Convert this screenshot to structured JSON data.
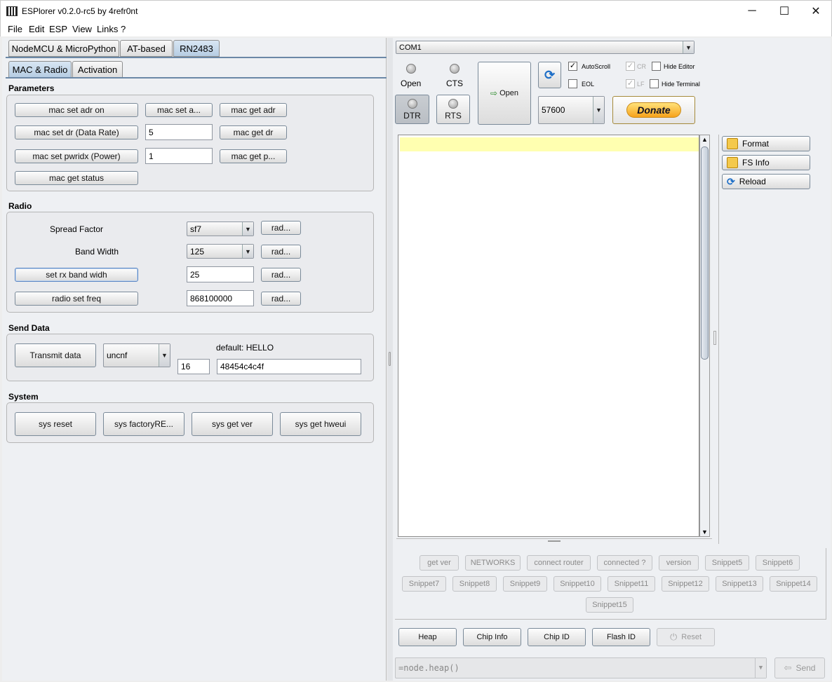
{
  "window": {
    "title": "ESPlorer v0.2.0-rc5 by 4refr0nt",
    "minimize_glyph": "─",
    "maximize_glyph": "☐",
    "close_glyph": "✕"
  },
  "menu": [
    "File",
    "Edit",
    "ESP",
    "View",
    "Links ?"
  ],
  "left": {
    "main_tabs": [
      "NodeMCU & MicroPython",
      "AT-based",
      "RN2483"
    ],
    "active_main_tab": "RN2483",
    "sub_tabs": [
      "MAC & Radio",
      "Activation"
    ],
    "active_sub_tab": "MAC & Radio",
    "parameters": {
      "title": "Parameters",
      "btn_set_adr": "mac set adr on",
      "btn_set_a": "mac set a...",
      "btn_get_adr": "mac get adr",
      "btn_set_dr": "mac set dr (Data Rate)",
      "dr_value": "5",
      "btn_get_dr": "mac get dr",
      "btn_set_pwridx": "mac set pwridx (Power)",
      "pwridx_value": "1",
      "btn_get_p": "mac get p...",
      "btn_get_status": "mac get status"
    },
    "radio": {
      "title": "Radio",
      "sf_label": "Spread Factor",
      "sf_value": "sf7",
      "bw_label": "Band Width",
      "bw_value": "125",
      "btn_rx_bw": "set rx band widh",
      "rx_bw_value": "25",
      "btn_set_freq": "radio set freq",
      "freq_value": "868100000",
      "rad_btn": "rad..."
    },
    "send": {
      "title": "Send Data",
      "btn_transmit": "Transmit data",
      "mode_value": "uncnf",
      "default_label": "default: HELLO",
      "port_value": "16",
      "payload_value": "48454c4c4f"
    },
    "system": {
      "title": "System",
      "btn_reset": "sys reset",
      "btn_factory": "sys factoryRE...",
      "btn_get_ver": "sys get ver",
      "btn_get_hweui": "sys get hweui"
    }
  },
  "right": {
    "port_value": "COM1",
    "led_open": "Open",
    "led_cts": "CTS",
    "btn_dtr": "DTR",
    "btn_rts": "RTS",
    "btn_open": "Open",
    "cb_autoscroll": "AutoScroll",
    "cb_eol": "EOL",
    "cb_cr": "CR",
    "cb_lf": "LF",
    "cb_hide_editor": "Hide Editor",
    "cb_hide_terminal": "Hide Terminal",
    "baud_value": "57600",
    "donate": "Donate",
    "fs_buttons": [
      "Format",
      "FS Info",
      "Reload"
    ],
    "snippets_row1": [
      "get ver",
      "NETWORKS",
      "connect router",
      "connected ?",
      "version",
      "Snippet5",
      "Snippet6"
    ],
    "snippets_row2": [
      "Snippet7",
      "Snippet8",
      "Snippet9",
      "Snippet10",
      "Snippet11",
      "Snippet12",
      "Snippet13",
      "Snippet14"
    ],
    "snippets_row3": [
      "Snippet15"
    ],
    "bottom_buttons": [
      "Heap",
      "Chip Info",
      "Chip ID",
      "Flash ID",
      "Reset"
    ],
    "command_value": "=node.heap()",
    "send_label": "Send"
  },
  "colors": {
    "donate_gradient_top": "#ffe27a",
    "donate_gradient_bottom": "#f7a21b",
    "editor_highlight": "#ffffb0"
  }
}
